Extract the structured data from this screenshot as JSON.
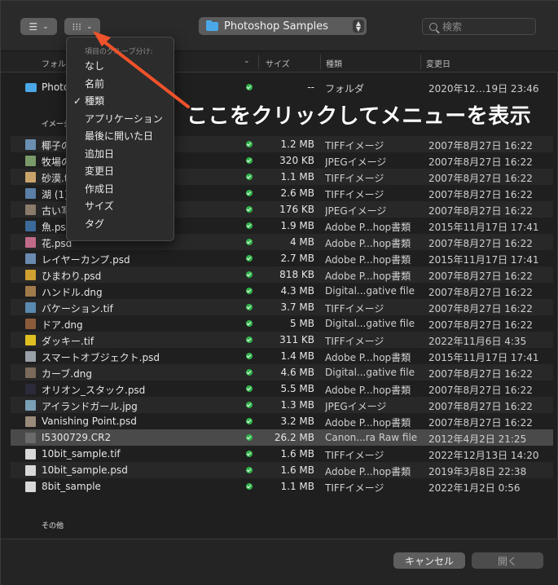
{
  "toolbar": {
    "view_button_icon": "list-icon",
    "group_button_icon": "grid-icon",
    "location": "Photoshop Samples",
    "search_placeholder": "検索"
  },
  "columns": {
    "name": "フォルダ",
    "size": "サイズ",
    "kind": "種類",
    "modified": "変更日"
  },
  "groups": {
    "folders": "",
    "images": "イメージ",
    "other": "その他"
  },
  "folder_row": {
    "name": "Photoshop Samples",
    "size": "--",
    "kind": "フォルダ",
    "date": "2020年12…19日 23:46"
  },
  "files": [
    {
      "name": "椰子の木.tif",
      "size": "1.2 MB",
      "kind": "TIFFイメージ",
      "date": "2007年8月27日 16:22",
      "icon_color": "#6b8fb0"
    },
    {
      "name": "牧場の風景.jpg",
      "size": "320 KB",
      "kind": "JPEGイメージ",
      "date": "2007年8月27日 16:22",
      "icon_color": "#7a9a6a"
    },
    {
      "name": "砂漠.tif",
      "size": "1.1 MB",
      "kind": "TIFFイメージ",
      "date": "2007年8月27日 16:22",
      "icon_color": "#c9a46a"
    },
    {
      "name": "湖 (1).tif",
      "size": "2.6 MB",
      "kind": "TIFFイメージ",
      "date": "2007年8月27日 16:22",
      "icon_color": "#5a7fa8"
    },
    {
      "name": "古い写真.jpg",
      "size": "176 KB",
      "kind": "JPEGイメージ",
      "date": "2007年8月27日 16:22",
      "icon_color": "#8a7a6a"
    },
    {
      "name": "魚.psd",
      "size": "1.9 MB",
      "kind": "Adobe P...hop書類",
      "date": "2015年11月17日 17:41",
      "icon_color": "#3a6a9a"
    },
    {
      "name": "花.psd",
      "size": "4 MB",
      "kind": "Adobe P...hop書類",
      "date": "2007年8月27日 16:22",
      "icon_color": "#c06a8a"
    },
    {
      "name": "レイヤーカンプ.psd",
      "size": "2.7 MB",
      "kind": "Adobe P...hop書類",
      "date": "2015年11月17日 17:41",
      "icon_color": "#6a8ab0"
    },
    {
      "name": "ひまわり.psd",
      "size": "818 KB",
      "kind": "Adobe P...hop書類",
      "date": "2007年8月27日 16:22",
      "icon_color": "#d0a030"
    },
    {
      "name": "ハンドル.dng",
      "size": "4.3 MB",
      "kind": "Digital...gative file",
      "date": "2007年8月27日 16:22",
      "icon_color": "#a07a4a"
    },
    {
      "name": "バケーション.tif",
      "size": "3.7 MB",
      "kind": "TIFFイメージ",
      "date": "2007年8月27日 16:22",
      "icon_color": "#5a8ab0"
    },
    {
      "name": "ドア.dng",
      "size": "5 MB",
      "kind": "Digital...gative file",
      "date": "2007年8月27日 16:22",
      "icon_color": "#8a5a3a"
    },
    {
      "name": "ダッキー.tif",
      "size": "311 KB",
      "kind": "TIFFイメージ",
      "date": "2022年11月6日 4:35",
      "icon_color": "#e0c020"
    },
    {
      "name": "スマートオブジェクト.psd",
      "size": "1.4 MB",
      "kind": "Adobe P...hop書類",
      "date": "2015年11月17日 17:41",
      "icon_color": "#9aa0a8"
    },
    {
      "name": "カーブ.dng",
      "size": "4.6 MB",
      "kind": "Digital...gative file",
      "date": "2007年8月27日 16:22",
      "icon_color": "#7a6a5a"
    },
    {
      "name": "オリオン_スタック.psd",
      "size": "5.5 MB",
      "kind": "Adobe P...hop書類",
      "date": "2007年8月27日 16:22",
      "icon_color": "#2a2a3a"
    },
    {
      "name": "アイランドガール.jpg",
      "size": "1.3 MB",
      "kind": "JPEGイメージ",
      "date": "2007年8月27日 16:22",
      "icon_color": "#7aa0b8"
    },
    {
      "name": "Vanishing Point.psd",
      "size": "3.2 MB",
      "kind": "Adobe P...hop書類",
      "date": "2007年8月27日 16:22",
      "icon_color": "#9a8a7a"
    },
    {
      "name": "I5300729.CR2",
      "size": "26.2 MB",
      "kind": "Canon...ra Raw file",
      "date": "2012年4月2日 21:25",
      "icon_color": "#6a6a6a",
      "selected": true
    },
    {
      "name": "10bit_sample.tif",
      "size": "1.6 MB",
      "kind": "TIFFイメージ",
      "date": "2022年12月13日 14:20",
      "icon_color": "#d8d8d8"
    },
    {
      "name": "10bit_sample.psd",
      "size": "1.6 MB",
      "kind": "Adobe P...hop書類",
      "date": "2019年3月8日 22:38",
      "icon_color": "#d8d8d8"
    },
    {
      "name": "8bit_sample",
      "size": "1.1 MB",
      "kind": "TIFFイメージ",
      "date": "2022年1月2日 0:56",
      "icon_color": "#d8d8d8"
    }
  ],
  "group_menu": {
    "title": "項目のグループ分け:",
    "items": [
      "なし",
      "名前",
      "種類",
      "アプリケーション",
      "最後に開いた日",
      "追加日",
      "変更日",
      "作成日",
      "サイズ",
      "タグ"
    ],
    "checked_index": 2,
    "check_glyph": "✓"
  },
  "annotation": "ここをクリックしてメニューを表示",
  "annotation_color": "#f0522a",
  "footer": {
    "cancel": "キャンセル",
    "open": "開く"
  }
}
